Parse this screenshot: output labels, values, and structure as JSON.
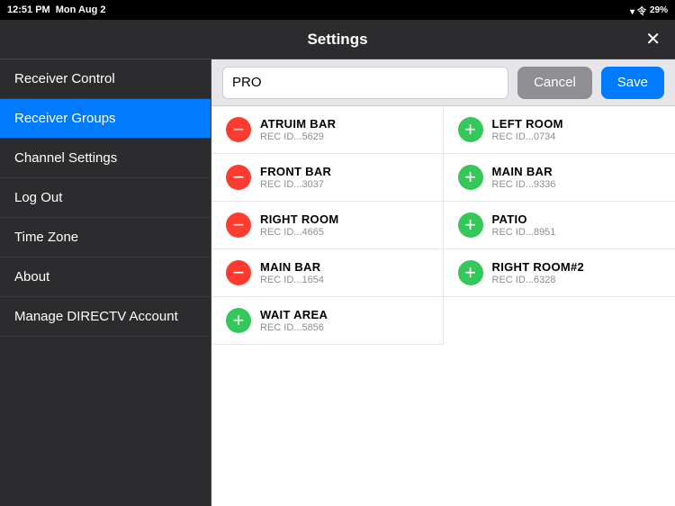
{
  "statusBar": {
    "time": "12:51 PM",
    "date": "Mon Aug 2",
    "battery": "29%"
  },
  "titleBar": {
    "title": "Settings",
    "closeLabel": "✕"
  },
  "sidebar": {
    "items": [
      {
        "id": "receiver-control",
        "label": "Receiver Control",
        "active": false
      },
      {
        "id": "receiver-groups",
        "label": "Receiver Groups",
        "active": true
      },
      {
        "id": "channel-settings",
        "label": "Channel Settings",
        "active": false
      },
      {
        "id": "log-out",
        "label": "Log Out",
        "active": false
      },
      {
        "id": "time-zone",
        "label": "Time Zone",
        "active": false
      },
      {
        "id": "about",
        "label": "About",
        "active": false
      },
      {
        "id": "manage-directv",
        "label": "Manage DIRECTV Account",
        "active": false
      }
    ]
  },
  "content": {
    "groupNameInput": {
      "value": "PRO",
      "placeholder": "Group Name"
    },
    "cancelLabel": "Cancel",
    "saveLabel": "Save",
    "receivers": [
      {
        "id": "atruim-bar",
        "name": "ATRUIM BAR",
        "recId": "REC ID...5629",
        "inGroup": true
      },
      {
        "id": "left-room",
        "name": "LEFT ROOM",
        "recId": "REC ID...0734",
        "inGroup": false
      },
      {
        "id": "front-bar",
        "name": "FRONT BAR",
        "recId": "REC ID...3037",
        "inGroup": true
      },
      {
        "id": "main-bar-1",
        "name": "MAIN BAR",
        "recId": "REC ID...9336",
        "inGroup": false
      },
      {
        "id": "right-room",
        "name": "RIGHT ROOM",
        "recId": "REC ID...4665",
        "inGroup": true
      },
      {
        "id": "patio",
        "name": "PATIO",
        "recId": "REC ID...8951",
        "inGroup": false
      },
      {
        "id": "main-bar-2",
        "name": "MAIN BAR",
        "recId": "REC ID...1654",
        "inGroup": true
      },
      {
        "id": "right-room2",
        "name": "RIGHT ROOM#2",
        "recId": "REC ID...6328",
        "inGroup": false
      },
      {
        "id": "wait-area",
        "name": "WAIT AREA",
        "recId": "REC ID...5856",
        "inGroup": false
      }
    ]
  }
}
